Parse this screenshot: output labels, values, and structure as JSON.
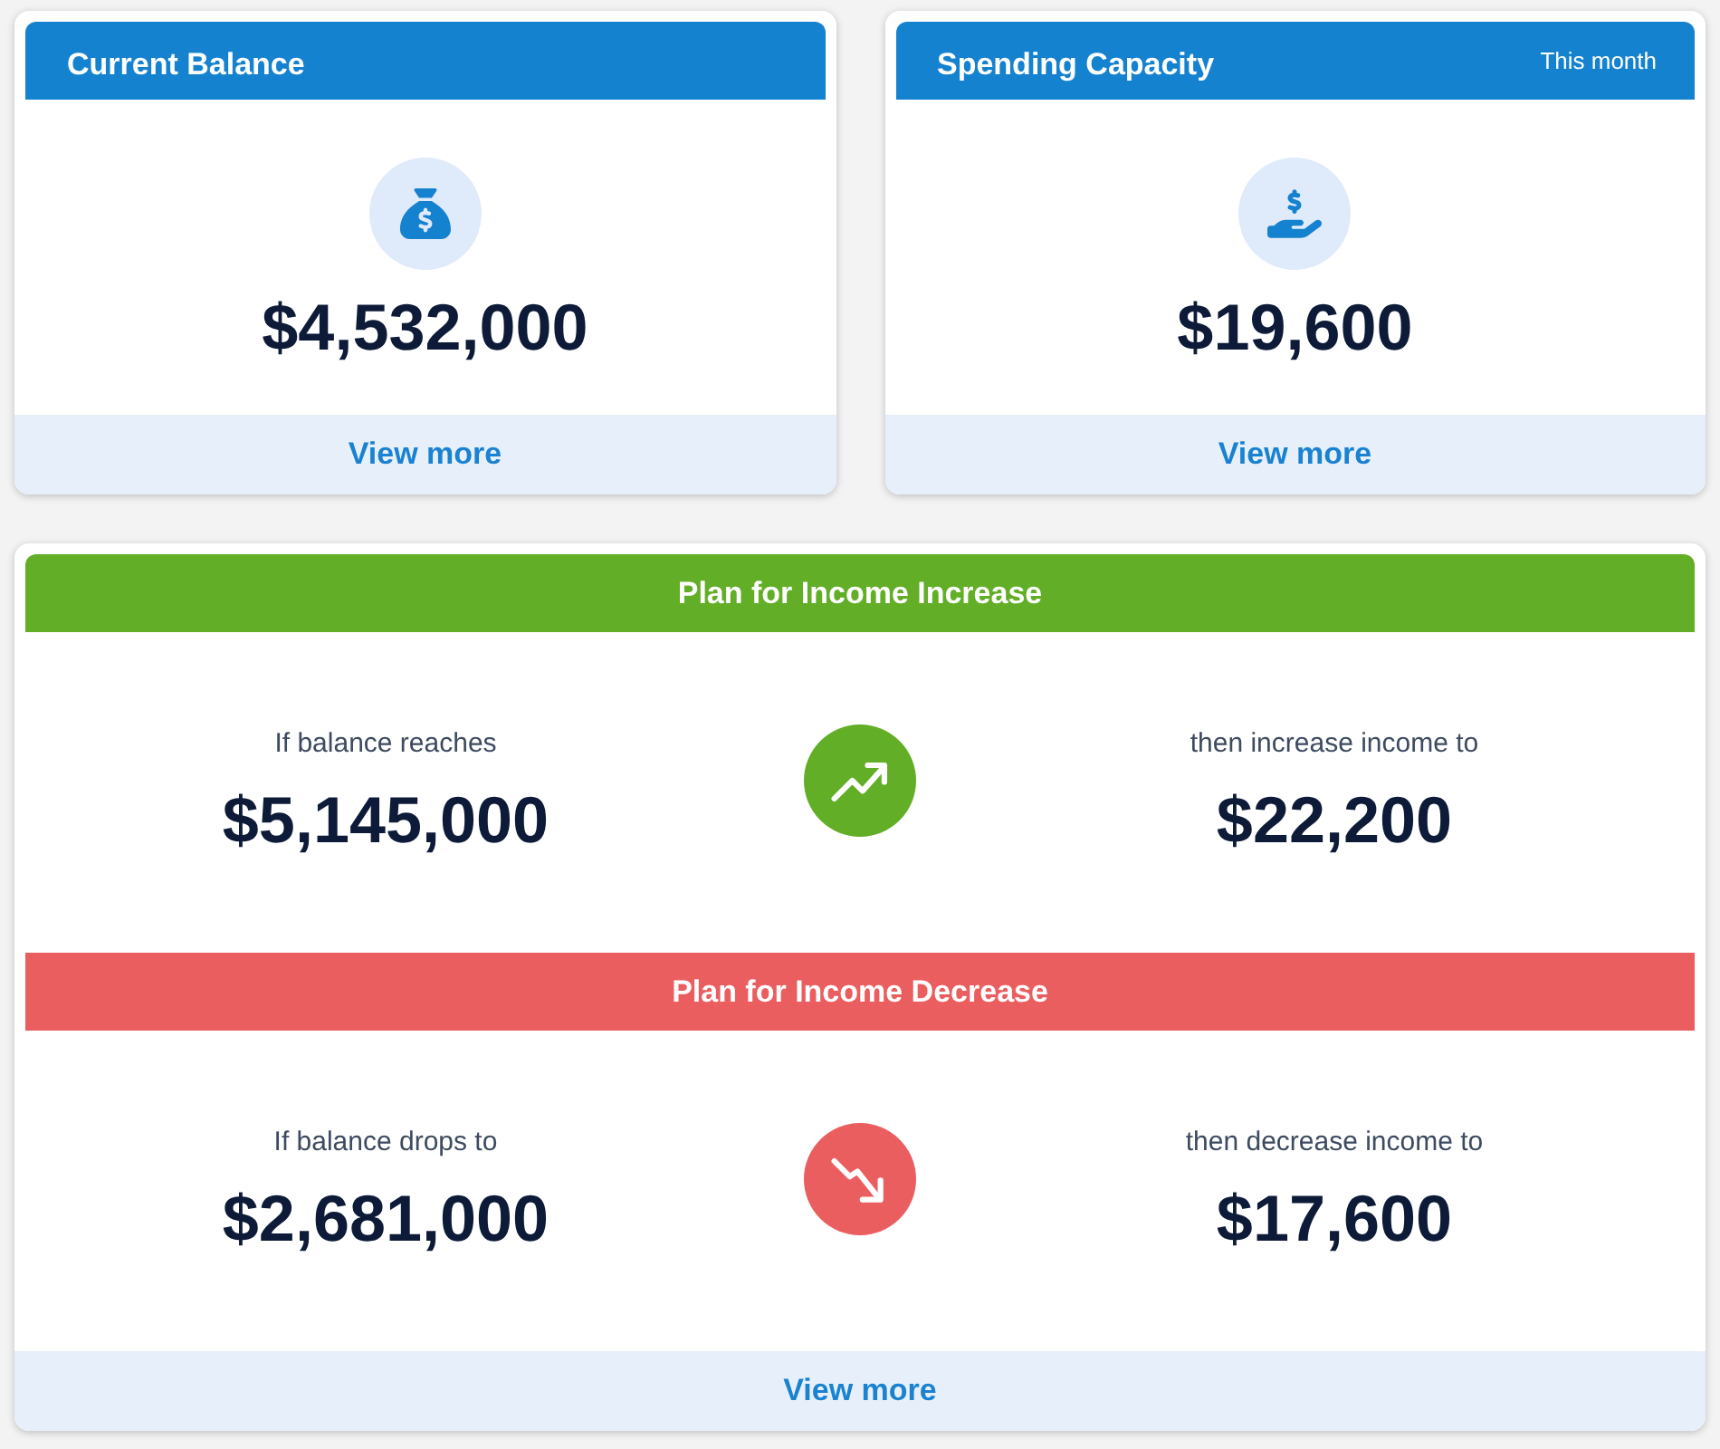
{
  "summary_cards": [
    {
      "title": "Current Balance",
      "amount": "$4,532,000",
      "link": "View more"
    },
    {
      "title": "Spending Capacity",
      "period": "This month",
      "amount": "$19,600",
      "link": "View more"
    }
  ],
  "plans_card": {
    "plans": [
      {
        "kind": "increase",
        "title": "Plan for Income Increase",
        "condition_label": "If balance reaches",
        "condition_amount": "$5,145,000",
        "action_label": "then increase income to",
        "action_amount": "$22,200"
      },
      {
        "kind": "decrease",
        "title": "Plan for Income Decrease",
        "condition_label": "If balance drops to",
        "condition_amount": "$2,681,000",
        "action_label": "then decrease income to",
        "action_amount": "$17,600"
      }
    ],
    "link": "View more"
  }
}
